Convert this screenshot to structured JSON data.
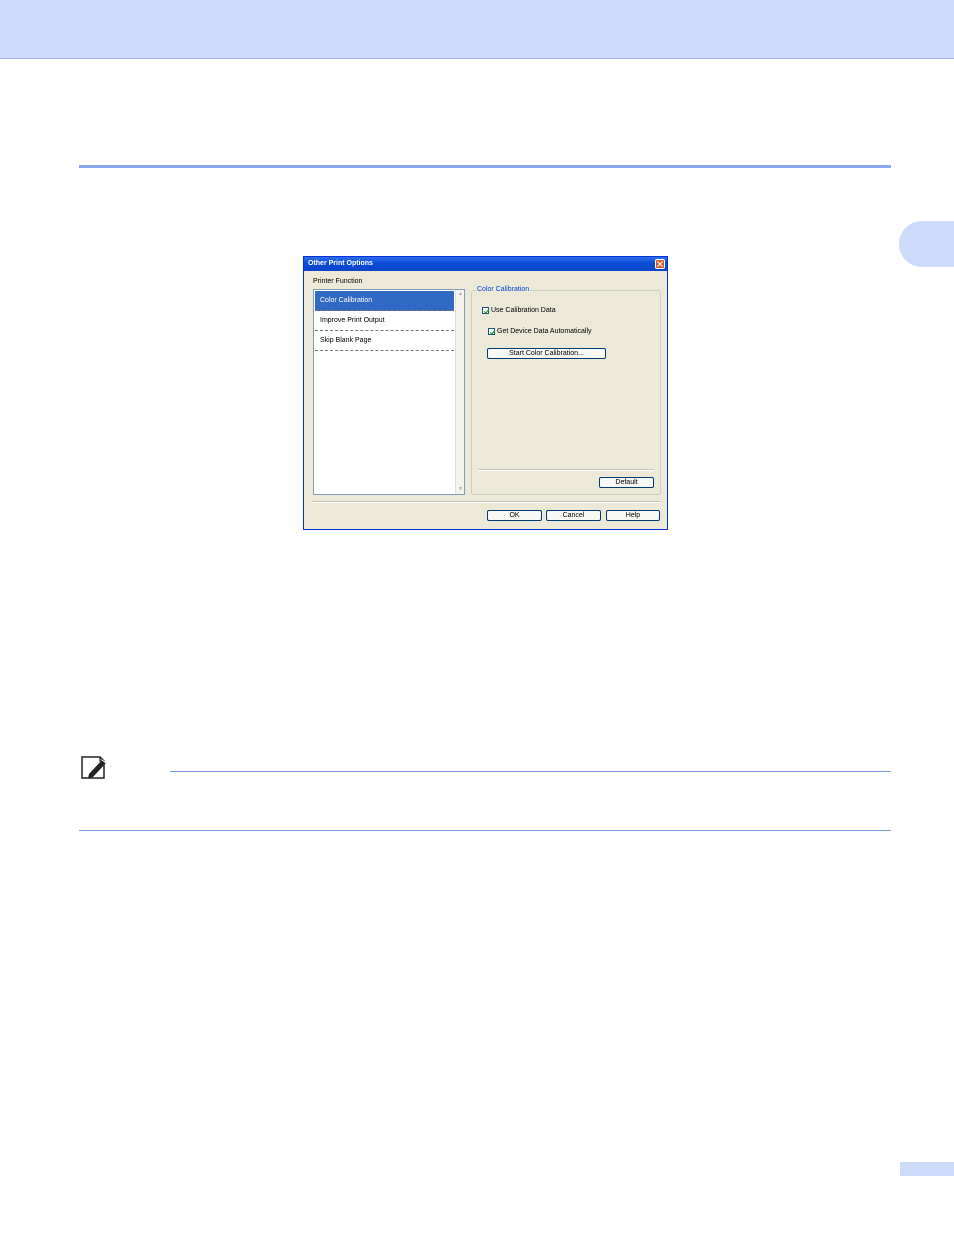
{
  "dialog": {
    "title": "Other Print Options",
    "printer_function_label": "Printer Function",
    "functions": [
      "Color Calibration",
      "Improve Print Output",
      "Skip Blank Page"
    ],
    "selected_function": "Color Calibration",
    "group_title": "Color Calibration",
    "use_calibration_data": {
      "label": "Use Calibration Data",
      "checked": true
    },
    "get_device_data": {
      "label": "Get Device Data Automatically",
      "checked": true
    },
    "start_calibration_button": "Start Color Calibration...",
    "default_button": "Default",
    "ok_button": "OK",
    "cancel_button": "Cancel",
    "help_button": "Help"
  },
  "colors": {
    "header_band": "#cddcfb",
    "rule": "#8aa8ee",
    "selection": "#316ac5",
    "titlebar": "#0a4bd6"
  }
}
